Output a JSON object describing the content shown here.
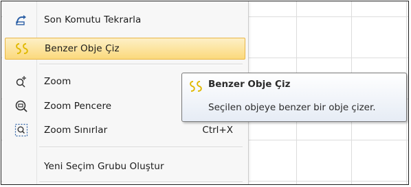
{
  "menu": {
    "items": [
      {
        "label": "Son Komutu Tekrarla",
        "icon": "repeat-arrow-icon",
        "shortcut": ""
      },
      {
        "label": "Benzer Obje Çiz",
        "icon": "similar-object-icon",
        "shortcut": "",
        "highlighted": true
      },
      {
        "label": "Zoom",
        "icon": "zoom-icon",
        "shortcut": ""
      },
      {
        "label": "Zoom Pencere",
        "icon": "zoom-window-icon",
        "shortcut": ""
      },
      {
        "label": "Zoom Sınırlar",
        "icon": "zoom-extents-icon",
        "shortcut": "Ctrl+X"
      },
      {
        "label": "Yeni Seçim Grubu Oluştur",
        "icon": "",
        "shortcut": ""
      }
    ]
  },
  "tooltip": {
    "title": "Benzer Obje Çiz",
    "description": "Seçilen objeye benzer bir obje çizer.",
    "icon": "similar-object-icon"
  },
  "colors": {
    "highlight_top": "#fdf0c6",
    "highlight_bottom": "#fbd97c",
    "highlight_border": "#e8b545",
    "icon_accent": "#e0b800",
    "icon_blue": "#2b5fa5"
  }
}
